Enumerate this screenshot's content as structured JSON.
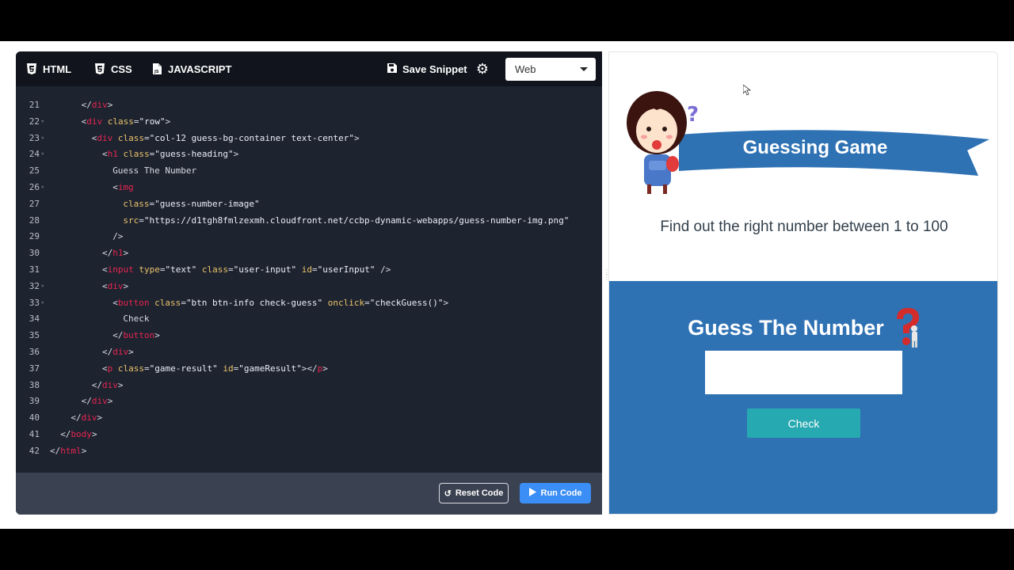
{
  "toolbar": {
    "tabs": [
      {
        "label": "HTML",
        "icon": "html5-icon",
        "active": true
      },
      {
        "label": "CSS",
        "icon": "css3-icon",
        "active": false
      },
      {
        "label": "JAVASCRIPT",
        "icon": "js-file-icon",
        "active": false
      }
    ],
    "save_label": "Save Snippet",
    "settings_icon": "gear-icon",
    "platform_select": {
      "value": "Web"
    }
  },
  "editor": {
    "lines": [
      {
        "n": "21",
        "fold": false
      },
      {
        "n": "22",
        "fold": true
      },
      {
        "n": "23",
        "fold": true
      },
      {
        "n": "24",
        "fold": true
      },
      {
        "n": "25",
        "fold": false
      },
      {
        "n": "26",
        "fold": true
      },
      {
        "n": "27",
        "fold": false
      },
      {
        "n": "28",
        "fold": false
      },
      {
        "n": "29",
        "fold": false
      },
      {
        "n": "30",
        "fold": false
      },
      {
        "n": "31",
        "fold": false
      },
      {
        "n": "32",
        "fold": true
      },
      {
        "n": "33",
        "fold": true
      },
      {
        "n": "34",
        "fold": false
      },
      {
        "n": "35",
        "fold": false
      },
      {
        "n": "36",
        "fold": false
      },
      {
        "n": "37",
        "fold": false
      },
      {
        "n": "38",
        "fold": false
      },
      {
        "n": "39",
        "fold": false
      },
      {
        "n": "40",
        "fold": false
      },
      {
        "n": "41",
        "fold": false
      },
      {
        "n": "42",
        "fold": false
      }
    ],
    "code": {
      "l21": [
        "</",
        "div",
        ">"
      ],
      "l22": [
        "<",
        "div",
        " class",
        "=",
        "\"row\"",
        ">"
      ],
      "l23": [
        "<",
        "div",
        " class",
        "=",
        "\"col-12 guess-bg-container text-center\"",
        ">"
      ],
      "l24": [
        "<",
        "h1",
        " class",
        "=",
        "\"guess-heading\"",
        ">"
      ],
      "l25": "Guess The Number",
      "l26": [
        "<",
        "img"
      ],
      "l27": [
        "class",
        "=",
        "\"guess-number-image\""
      ],
      "l28": [
        "src",
        "=",
        "\"https://d1tgh8fmlzexmh.cloudfront.net/ccbp-dynamic-webapps/guess-number-img.png\""
      ],
      "l29": "/>",
      "l30": [
        "</",
        "h1",
        ">"
      ],
      "l31": [
        "<",
        "input",
        " type",
        "=",
        "\"text\"",
        " class",
        "=",
        "\"user-input\"",
        " id",
        "=",
        "\"userInput\"",
        " />"
      ],
      "l32": [
        "<",
        "div",
        ">"
      ],
      "l33": [
        "<",
        "button",
        " class",
        "=",
        "\"btn btn-info check-guess\"",
        " onclick",
        "=",
        "\"checkGuess()\"",
        ">"
      ],
      "l34": "Check",
      "l35": [
        "</",
        "button",
        ">"
      ],
      "l36": [
        "</",
        "div",
        ">"
      ],
      "l37": [
        "<",
        "p",
        " class",
        "=",
        "\"game-result\"",
        " id",
        "=",
        "\"gameResult\"",
        "></",
        "p",
        ">"
      ],
      "l38": [
        "</",
        "div",
        ">"
      ],
      "l39": [
        "</",
        "div",
        ">"
      ],
      "l40": [
        "</",
        "div",
        ">"
      ],
      "l41": [
        "</",
        "body",
        ">"
      ],
      "l42": [
        "</",
        "html",
        ">"
      ]
    }
  },
  "footer": {
    "reset_label": "Reset Code",
    "run_label": "Run Code"
  },
  "preview": {
    "banner_title": "Guessing Game",
    "subtitle": "Find out the right number between 1 to 100",
    "game_heading": "Guess The Number",
    "input_value": "",
    "check_label": "Check"
  },
  "colors": {
    "editor_bg": "#1e2330",
    "tag": "#e6254f",
    "attr": "#e9c46a",
    "game_bg": "#2f72b4",
    "check_btn": "#27a9b1",
    "run_btn": "#3b8ef5"
  }
}
